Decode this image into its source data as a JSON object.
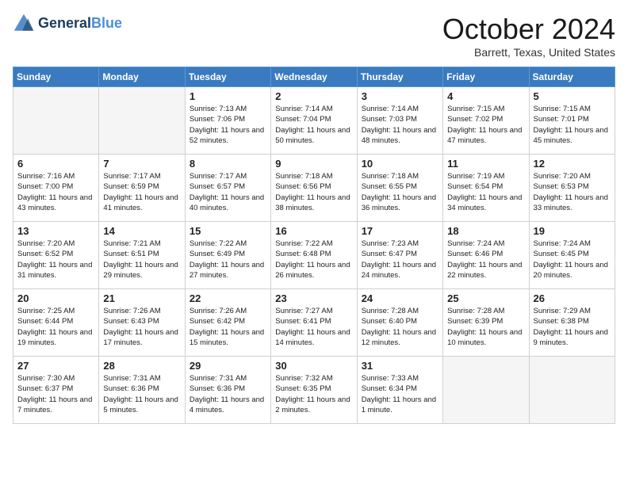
{
  "header": {
    "logo_line1": "General",
    "logo_line2": "Blue",
    "month": "October 2024",
    "location": "Barrett, Texas, United States"
  },
  "weekdays": [
    "Sunday",
    "Monday",
    "Tuesday",
    "Wednesday",
    "Thursday",
    "Friday",
    "Saturday"
  ],
  "weeks": [
    [
      {
        "day": "",
        "info": ""
      },
      {
        "day": "",
        "info": ""
      },
      {
        "day": "1",
        "info": "Sunrise: 7:13 AM\nSunset: 7:06 PM\nDaylight: 11 hours and 52 minutes."
      },
      {
        "day": "2",
        "info": "Sunrise: 7:14 AM\nSunset: 7:04 PM\nDaylight: 11 hours and 50 minutes."
      },
      {
        "day": "3",
        "info": "Sunrise: 7:14 AM\nSunset: 7:03 PM\nDaylight: 11 hours and 48 minutes."
      },
      {
        "day": "4",
        "info": "Sunrise: 7:15 AM\nSunset: 7:02 PM\nDaylight: 11 hours and 47 minutes."
      },
      {
        "day": "5",
        "info": "Sunrise: 7:15 AM\nSunset: 7:01 PM\nDaylight: 11 hours and 45 minutes."
      }
    ],
    [
      {
        "day": "6",
        "info": "Sunrise: 7:16 AM\nSunset: 7:00 PM\nDaylight: 11 hours and 43 minutes."
      },
      {
        "day": "7",
        "info": "Sunrise: 7:17 AM\nSunset: 6:59 PM\nDaylight: 11 hours and 41 minutes."
      },
      {
        "day": "8",
        "info": "Sunrise: 7:17 AM\nSunset: 6:57 PM\nDaylight: 11 hours and 40 minutes."
      },
      {
        "day": "9",
        "info": "Sunrise: 7:18 AM\nSunset: 6:56 PM\nDaylight: 11 hours and 38 minutes."
      },
      {
        "day": "10",
        "info": "Sunrise: 7:18 AM\nSunset: 6:55 PM\nDaylight: 11 hours and 36 minutes."
      },
      {
        "day": "11",
        "info": "Sunrise: 7:19 AM\nSunset: 6:54 PM\nDaylight: 11 hours and 34 minutes."
      },
      {
        "day": "12",
        "info": "Sunrise: 7:20 AM\nSunset: 6:53 PM\nDaylight: 11 hours and 33 minutes."
      }
    ],
    [
      {
        "day": "13",
        "info": "Sunrise: 7:20 AM\nSunset: 6:52 PM\nDaylight: 11 hours and 31 minutes."
      },
      {
        "day": "14",
        "info": "Sunrise: 7:21 AM\nSunset: 6:51 PM\nDaylight: 11 hours and 29 minutes."
      },
      {
        "day": "15",
        "info": "Sunrise: 7:22 AM\nSunset: 6:49 PM\nDaylight: 11 hours and 27 minutes."
      },
      {
        "day": "16",
        "info": "Sunrise: 7:22 AM\nSunset: 6:48 PM\nDaylight: 11 hours and 26 minutes."
      },
      {
        "day": "17",
        "info": "Sunrise: 7:23 AM\nSunset: 6:47 PM\nDaylight: 11 hours and 24 minutes."
      },
      {
        "day": "18",
        "info": "Sunrise: 7:24 AM\nSunset: 6:46 PM\nDaylight: 11 hours and 22 minutes."
      },
      {
        "day": "19",
        "info": "Sunrise: 7:24 AM\nSunset: 6:45 PM\nDaylight: 11 hours and 20 minutes."
      }
    ],
    [
      {
        "day": "20",
        "info": "Sunrise: 7:25 AM\nSunset: 6:44 PM\nDaylight: 11 hours and 19 minutes."
      },
      {
        "day": "21",
        "info": "Sunrise: 7:26 AM\nSunset: 6:43 PM\nDaylight: 11 hours and 17 minutes."
      },
      {
        "day": "22",
        "info": "Sunrise: 7:26 AM\nSunset: 6:42 PM\nDaylight: 11 hours and 15 minutes."
      },
      {
        "day": "23",
        "info": "Sunrise: 7:27 AM\nSunset: 6:41 PM\nDaylight: 11 hours and 14 minutes."
      },
      {
        "day": "24",
        "info": "Sunrise: 7:28 AM\nSunset: 6:40 PM\nDaylight: 11 hours and 12 minutes."
      },
      {
        "day": "25",
        "info": "Sunrise: 7:28 AM\nSunset: 6:39 PM\nDaylight: 11 hours and 10 minutes."
      },
      {
        "day": "26",
        "info": "Sunrise: 7:29 AM\nSunset: 6:38 PM\nDaylight: 11 hours and 9 minutes."
      }
    ],
    [
      {
        "day": "27",
        "info": "Sunrise: 7:30 AM\nSunset: 6:37 PM\nDaylight: 11 hours and 7 minutes."
      },
      {
        "day": "28",
        "info": "Sunrise: 7:31 AM\nSunset: 6:36 PM\nDaylight: 11 hours and 5 minutes."
      },
      {
        "day": "29",
        "info": "Sunrise: 7:31 AM\nSunset: 6:36 PM\nDaylight: 11 hours and 4 minutes."
      },
      {
        "day": "30",
        "info": "Sunrise: 7:32 AM\nSunset: 6:35 PM\nDaylight: 11 hours and 2 minutes."
      },
      {
        "day": "31",
        "info": "Sunrise: 7:33 AM\nSunset: 6:34 PM\nDaylight: 11 hours and 1 minute."
      },
      {
        "day": "",
        "info": ""
      },
      {
        "day": "",
        "info": ""
      }
    ]
  ]
}
